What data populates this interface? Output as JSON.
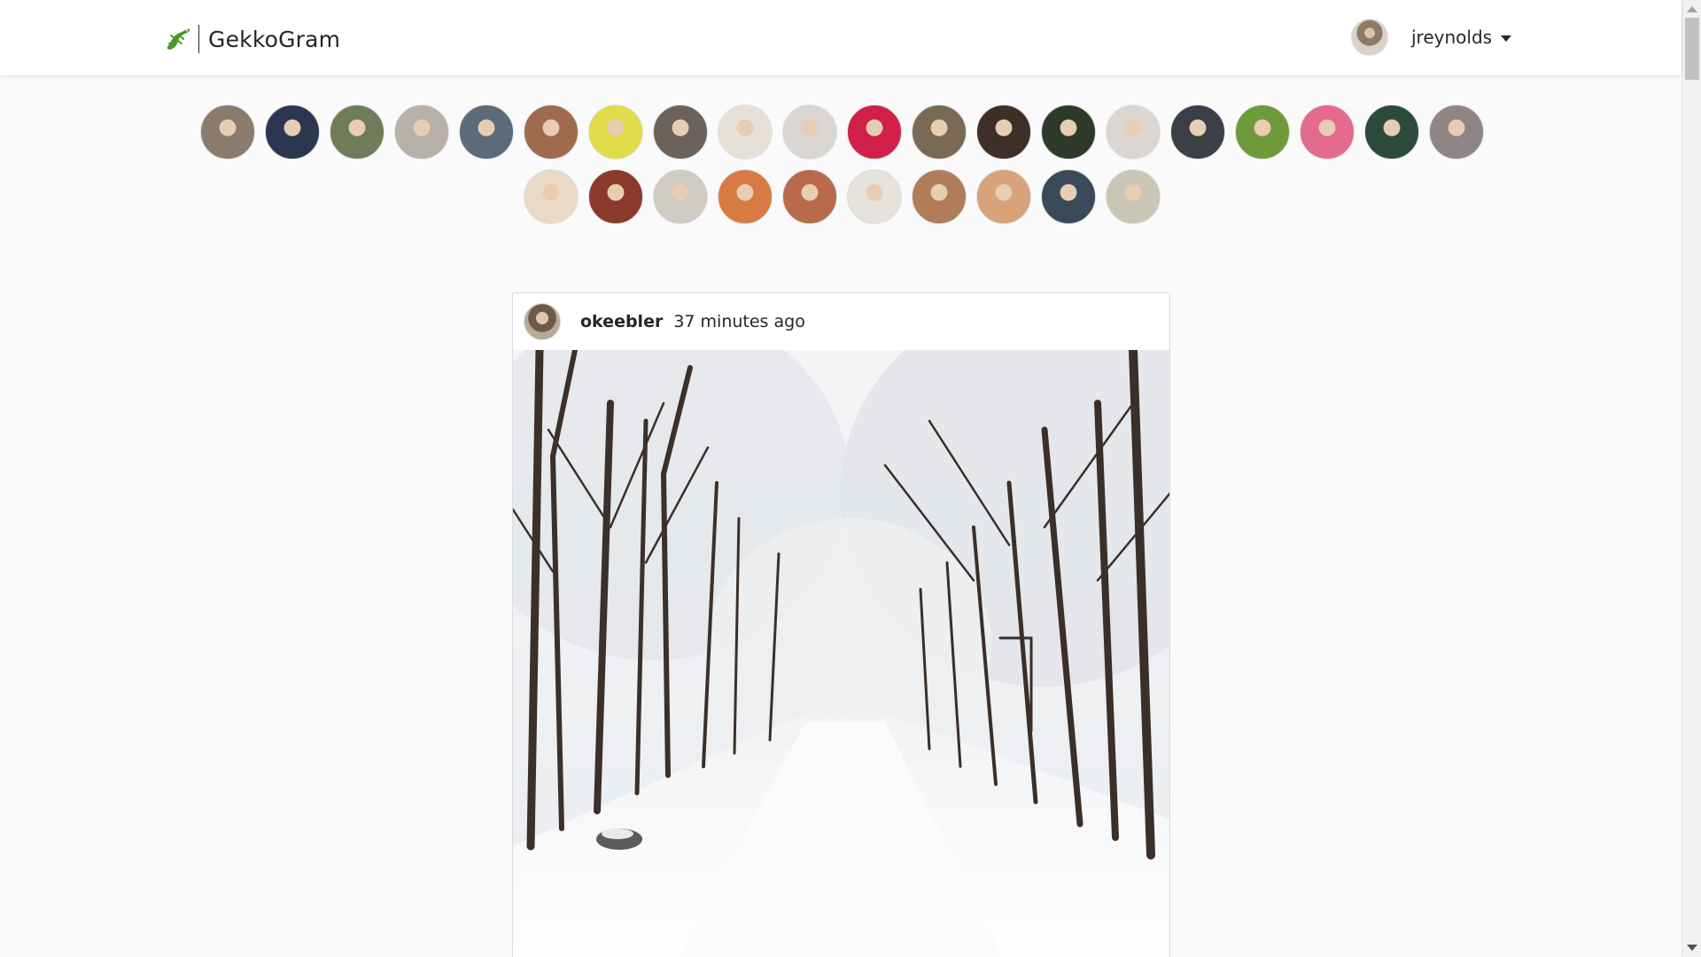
{
  "header": {
    "brand_name": "GekkoGram",
    "username": "jreynolds"
  },
  "stories": {
    "row1": [
      {
        "name": "story-avatar-1",
        "color": "#8a7b6c"
      },
      {
        "name": "story-avatar-2",
        "color": "#2b3650"
      },
      {
        "name": "story-avatar-3",
        "color": "#6f7c5a"
      },
      {
        "name": "story-avatar-4",
        "color": "#b7b1a8"
      },
      {
        "name": "story-avatar-5",
        "color": "#5c6a7a"
      },
      {
        "name": "story-avatar-6",
        "color": "#a06a4e"
      },
      {
        "name": "story-avatar-7",
        "color": "#e0dc4a"
      },
      {
        "name": "story-avatar-8",
        "color": "#6d625a"
      },
      {
        "name": "story-avatar-9",
        "color": "#e6e0d6"
      },
      {
        "name": "story-avatar-10",
        "color": "#d9d6d4"
      },
      {
        "name": "story-avatar-11",
        "color": "#d0204a"
      },
      {
        "name": "story-avatar-12",
        "color": "#7a6a55"
      },
      {
        "name": "story-avatar-13",
        "color": "#3e2f28"
      },
      {
        "name": "story-avatar-14",
        "color": "#2d3a2a"
      },
      {
        "name": "story-avatar-15",
        "color": "#dcd6d2"
      },
      {
        "name": "story-avatar-16",
        "color": "#3a3f48"
      },
      {
        "name": "story-avatar-17",
        "color": "#6f9a3a"
      },
      {
        "name": "story-avatar-18",
        "color": "#e46a8e"
      },
      {
        "name": "story-avatar-19",
        "color": "#2c4a3c"
      },
      {
        "name": "story-avatar-20",
        "color": "#8f8486"
      }
    ],
    "row2": [
      {
        "name": "story-avatar-21",
        "color": "#ead9c4"
      },
      {
        "name": "story-avatar-22",
        "color": "#8a3a2a"
      },
      {
        "name": "story-avatar-23",
        "color": "#cfcac2"
      },
      {
        "name": "story-avatar-24",
        "color": "#d77b43"
      },
      {
        "name": "story-avatar-25",
        "color": "#b86a4a"
      },
      {
        "name": "story-avatar-26",
        "color": "#e6e2dc"
      },
      {
        "name": "story-avatar-27",
        "color": "#b07c5a"
      },
      {
        "name": "story-avatar-28",
        "color": "#d8a27a"
      },
      {
        "name": "story-avatar-29",
        "color": "#3b4a5a"
      },
      {
        "name": "story-avatar-30",
        "color": "#c9c6b5"
      }
    ]
  },
  "post": {
    "username": "okeebler",
    "time": "37 minutes ago"
  },
  "colors": {
    "background": "#fafafa",
    "text": "#262626",
    "border": "#dbdbdb"
  }
}
